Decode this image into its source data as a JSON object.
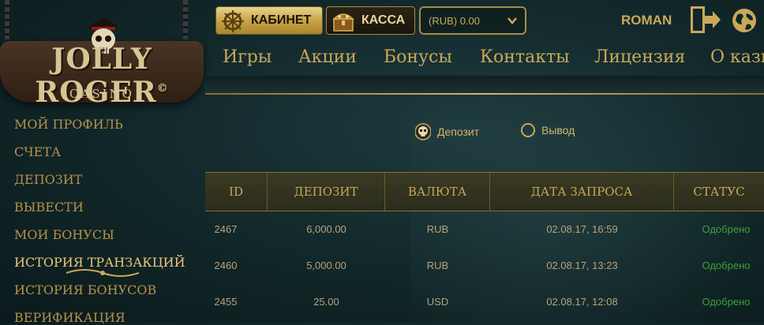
{
  "logo": {
    "title": "JOLLY ROGER",
    "sub": "CASINO",
    "mark": "©"
  },
  "header": {
    "cabinet_label": "КАБИНЕТ",
    "kassa_label": "КАССА",
    "balance": "(RUB) 0.00",
    "username": "ROMAN"
  },
  "nav": {
    "items": [
      "Игры",
      "Акции",
      "Бонусы",
      "Контакты",
      "Лицензия",
      "О кази"
    ]
  },
  "sidebar": {
    "items": [
      "МОЙ ПРОФИЛЬ",
      "СЧЕТА",
      "ДЕПОЗИТ",
      "ВЫВЕСТИ",
      "МОИ БОНУСЫ",
      "ИСТОРИЯ ТРАНЗАКЦИЙ",
      "ИСТОРИЯ БОНУСОВ",
      "ВЕРИФИКАЦИЯ"
    ],
    "active_index": 5
  },
  "filter": {
    "options": [
      "Депозит",
      "Вывод"
    ],
    "selected": "Депозит"
  },
  "table": {
    "headers": [
      "ID",
      "ДЕПОЗИТ",
      "ВАЛЮТА",
      "ДАТА ЗАПРОСА",
      "СТАТУС"
    ],
    "rows": [
      [
        "2467",
        "6,000.00",
        "RUB",
        "02.08.17, 16:59",
        "Одобрено"
      ],
      [
        "2460",
        "5,000.00",
        "RUB",
        "02.08.17, 13:23",
        "Одобрено"
      ],
      [
        "2455",
        "25.00",
        "USD",
        "02.08.17, 12:08",
        "Одобрено"
      ]
    ]
  },
  "colors": {
    "gold": "#c9a85a",
    "status_ok": "#3aa23a",
    "bg": "#112628"
  }
}
